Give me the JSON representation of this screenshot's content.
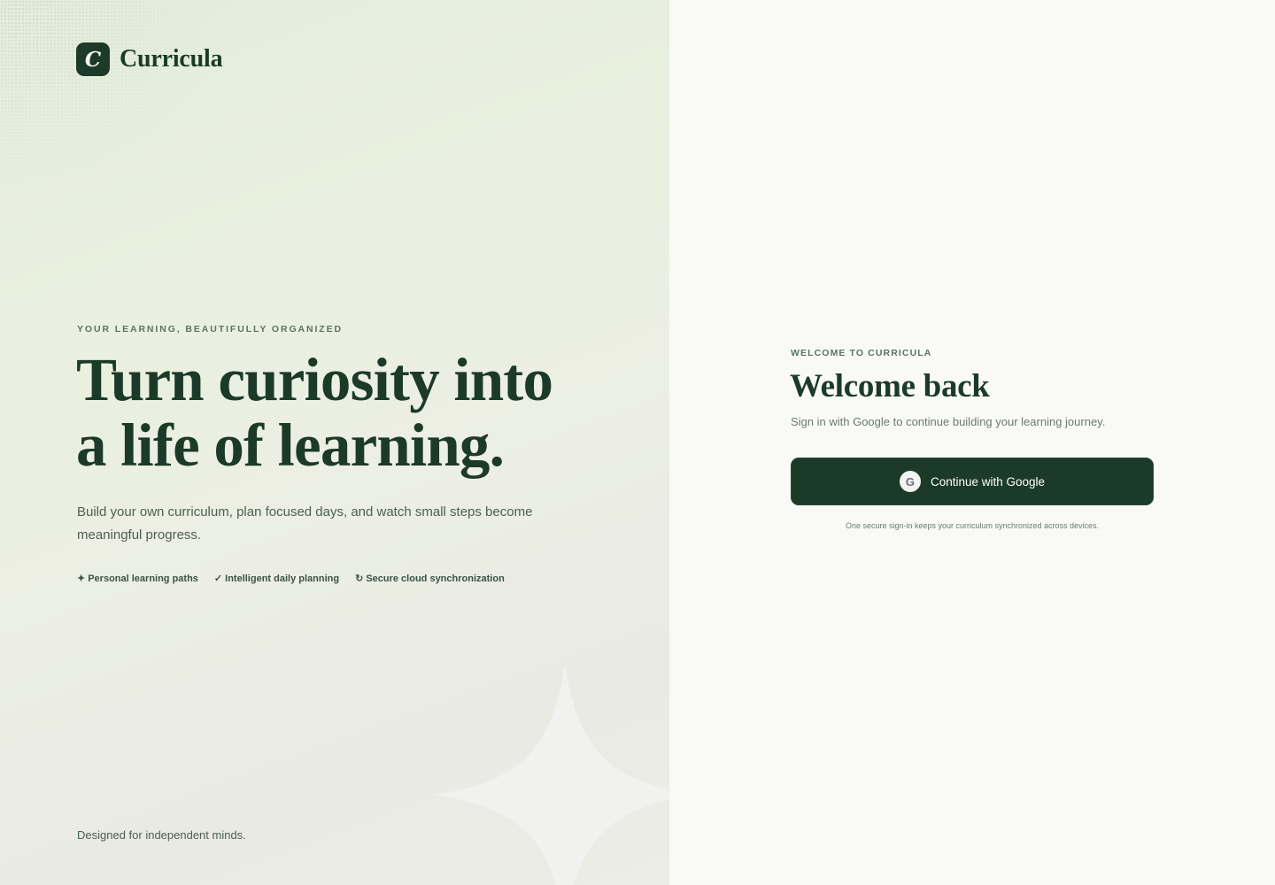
{
  "brand": {
    "logo_letter": "C",
    "name": "Curricula"
  },
  "hero": {
    "eyebrow": "YOUR LEARNING, BEAUTIFULLY ORGANIZED",
    "title_line1": "Turn curiosity into",
    "title_line2": "a life of learning.",
    "subtitle": "Build your own curriculum, plan focused days, and watch small steps become meaningful progress.",
    "features": [
      {
        "icon": "sparkle-icon",
        "glyph": "✦",
        "label": "Personal learning paths"
      },
      {
        "icon": "check-icon",
        "glyph": "✓",
        "label": "Intelligent daily planning"
      },
      {
        "icon": "sync-icon",
        "glyph": "↻",
        "label": "Secure cloud synchronization"
      }
    ],
    "footer": "Designed for independent minds."
  },
  "signin": {
    "eyebrow": "WELCOME TO CURRICULA",
    "title": "Welcome back",
    "subtitle": "Sign in with Google to continue building your learning journey.",
    "google_icon_letter": "G",
    "button_label": "Continue with Google",
    "note": "One secure sign-in keeps your curriculum synchronized across devices."
  },
  "colors": {
    "brand_dark_green": "#1c3a28",
    "background": "#f9faf6",
    "muted_text": "#6a7a6f"
  }
}
